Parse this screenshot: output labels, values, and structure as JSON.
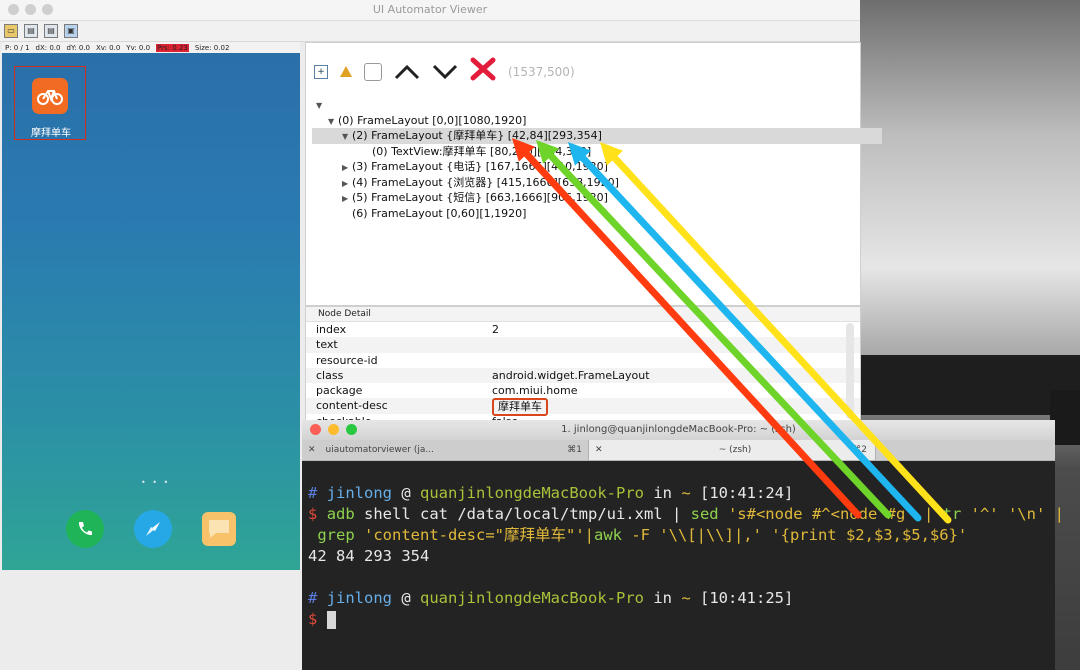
{
  "uia": {
    "title": "UI Automator Viewer",
    "pointer_bar": [
      "P: 0 / 1",
      "dX: 0.0",
      "dY: 0.0",
      "Xv: 0.0",
      "Yv: 0.0",
      "Prs: 0.23",
      "Size: 0.02"
    ],
    "coord_readout": "(1537,500)"
  },
  "phone": {
    "app_label": "摩拜单车",
    "page_dots": "• • •"
  },
  "tree": [
    {
      "label": "(0) FrameLayout [0,0][1080,1920]",
      "indent": 0,
      "arrow": "▼"
    },
    {
      "label": "(2) FrameLayout {摩拜单车} [42,84][293,354]",
      "indent": 1,
      "arrow": "▼",
      "selected": true
    },
    {
      "label": "(0) TextView:摩拜单车 [80,230][254,300]",
      "indent": 2,
      "arrow": ""
    },
    {
      "label": "(3) FrameLayout {电话} [167,1666][410,1920]",
      "indent": 1,
      "arrow": "▶"
    },
    {
      "label": "(4) FrameLayout {浏览器} [415,1666][658,1920]",
      "indent": 1,
      "arrow": "▶"
    },
    {
      "label": "(5) FrameLayout {短信} [663,1666][906,1920]",
      "indent": 1,
      "arrow": "▶"
    },
    {
      "label": "(6) FrameLayout [0,60][1,1920]",
      "indent": 1,
      "arrow": ""
    }
  ],
  "detail": {
    "header": "Node Detail",
    "rows": [
      {
        "k": "index",
        "v": "2"
      },
      {
        "k": "text",
        "v": ""
      },
      {
        "k": "resource-id",
        "v": ""
      },
      {
        "k": "class",
        "v": "android.widget.FrameLayout"
      },
      {
        "k": "package",
        "v": "com.miui.home"
      },
      {
        "k": "content-desc",
        "v": "摩拜单车"
      },
      {
        "k": "checkable",
        "v": "false"
      }
    ]
  },
  "terminal": {
    "title": "1. jinlong@quanjinlongdeMacBook-Pro: ~ (zsh)",
    "tab1": "uiautomatorviewer (ja...",
    "tab1_shortcut": "⌘1",
    "tab2": "~ (zsh)",
    "tab2_shortcut": "⌘2",
    "prompt1_user": "jinlong",
    "prompt1_host": "quanjinlongdeMacBook-Pro",
    "prompt1_time": "[10:41:24]",
    "cmd_line1_a": "adb",
    "cmd_line1_b": " shell cat /data/local/tmp/ui.xml | ",
    "cmd_line1_c": "sed",
    "cmd_line1_d": " 's#<node #^<node #g' |",
    "cmd_line1_e": "tr",
    "cmd_line1_f": " '^' '\\n' |",
    "cmd_line2_a": "grep",
    "cmd_line2_b": " 'content-desc=\"摩拜单车\"'|",
    "cmd_line2_c": "awk",
    "cmd_line2_d": " -F '\\\\[|\\\\]|,' '{print $2,$3,$5,$6}'",
    "output": "42 84 293 354",
    "prompt2_user": "jinlong",
    "prompt2_host": "quanjinlongdeMacBook-Pro",
    "prompt2_time": "[10:41:25]"
  },
  "colors": {
    "arrow_red": "#ff3b0f",
    "arrow_green": "#6fd42a",
    "arrow_blue": "#1fb5ee",
    "arrow_yellow": "#ffe21a"
  }
}
